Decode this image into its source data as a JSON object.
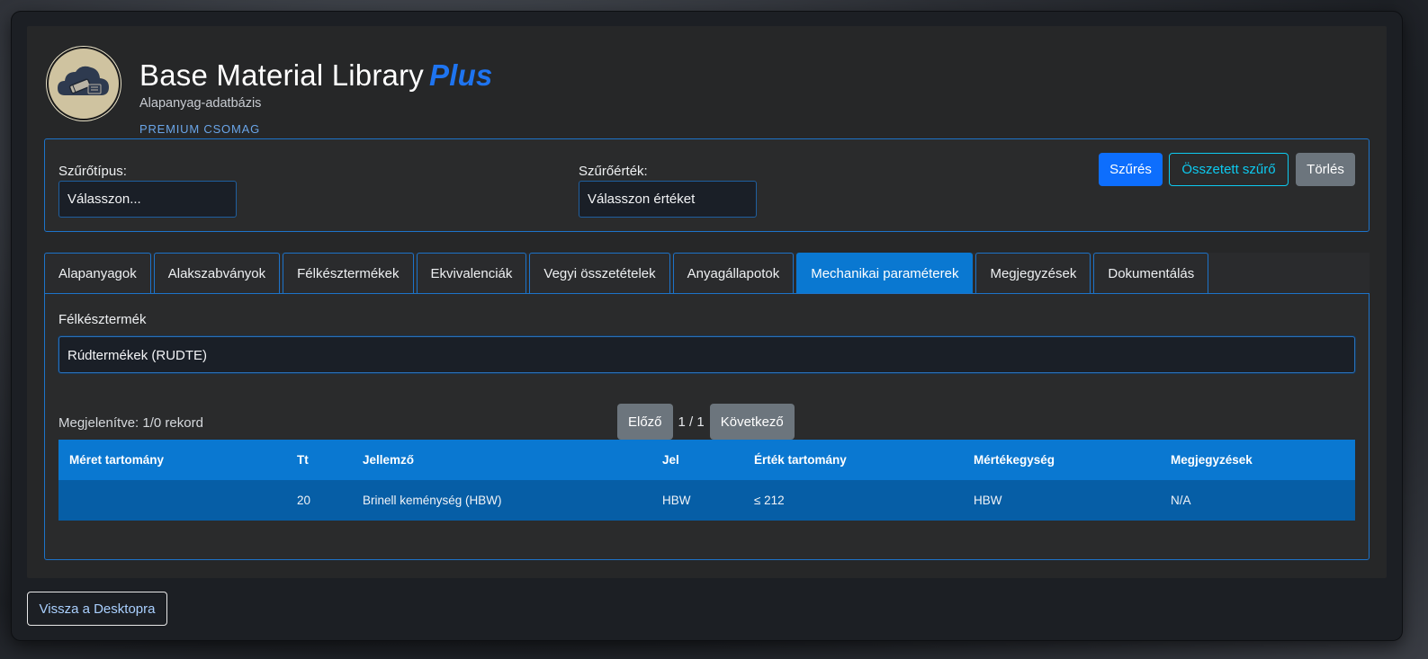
{
  "header": {
    "title": "Base Material Library",
    "title_accent": "Plus",
    "subtitle": "Alapanyag-adatbázis",
    "package": "PREMIUM CSOMAG",
    "logo_icon": "cloud-database-icon"
  },
  "filter": {
    "type_label": "Szűrőtípus:",
    "type_value": "Válasszon...",
    "value_label": "Szűrőérték:",
    "value_value": "Válasszon értéket",
    "filter_button": "Szűrés",
    "compound_button": "Összetett szűrő",
    "clear_button": "Törlés"
  },
  "tabs": [
    {
      "label": "Alapanyagok",
      "active": false
    },
    {
      "label": "Alakszabványok",
      "active": false
    },
    {
      "label": "Félkésztermékek",
      "active": false
    },
    {
      "label": "Ekvivalenciák",
      "active": false
    },
    {
      "label": "Vegyi összetételek",
      "active": false
    },
    {
      "label": "Anyagállapotok",
      "active": false
    },
    {
      "label": "Mechanikai paraméterek",
      "active": true
    },
    {
      "label": "Megjegyzések",
      "active": false
    },
    {
      "label": "Dokumentálás",
      "active": false
    }
  ],
  "panel": {
    "product_label": "Félkésztermék",
    "product_value": "Rúdtermékek (RUDTE)",
    "records_text": "Megjelenítve: 1/0 rekord",
    "prev_button": "Előző",
    "page_info": "1 / 1",
    "next_button": "Következő"
  },
  "table": {
    "columns": [
      "Méret tartomány",
      "Tt",
      "Jellemző",
      "Jel",
      "Érték tartomány",
      "Mértékegység",
      "Megjegyzések"
    ],
    "rows": [
      [
        "",
        "20",
        "Brinell keménység (HBW)",
        "HBW",
        "≤ 212",
        "HBW",
        "N/A"
      ]
    ]
  },
  "footer": {
    "back_button": "Vissza a Desktopra"
  },
  "colors": {
    "accent": "#0d6efd",
    "tab_active": "#0a78d1",
    "table_row": "#065ea6",
    "info": "#0dcaf0",
    "secondary": "#6c757d"
  }
}
